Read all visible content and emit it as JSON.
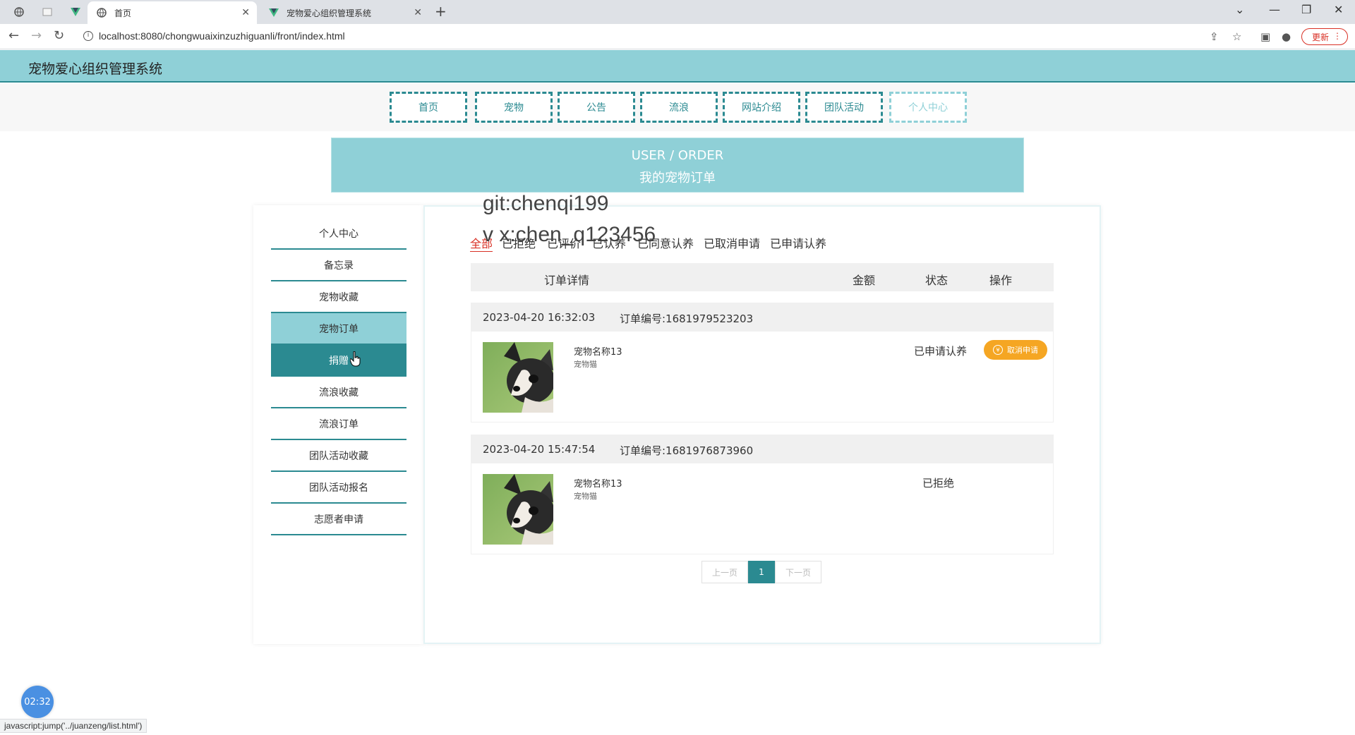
{
  "browser": {
    "tabs": [
      {
        "label": "首页",
        "icon": "globe-icon",
        "active": true
      },
      {
        "label": "宠物爱心组织管理系统",
        "icon": "vue-logo-icon",
        "active": false
      }
    ],
    "url": "localhost:8080/chongwuaixinzuzhiguanli/front/index.html",
    "update_label": "更新",
    "status_text": "javascript:jump('../juanzeng/list.html')"
  },
  "site": {
    "title": "宠物爱心组织管理系统",
    "menu": [
      "首页",
      "宠物",
      "公告",
      "流浪",
      "网站介绍",
      "团队活动",
      "个人中心"
    ],
    "banner_en": "USER / ORDER",
    "banner_zh": "我的宠物订单"
  },
  "sidebar": {
    "items": [
      "个人中心",
      "备忘录",
      "宠物收藏",
      "宠物订单",
      "捐赠",
      "流浪收藏",
      "流浪订单",
      "团队活动收藏",
      "团队活动报名",
      "志愿者申请"
    ]
  },
  "watermark": {
    "line1": "git:chenqi199",
    "line2": "v x:chen_q123456"
  },
  "filters": [
    "全部",
    "已拒绝",
    "已评价",
    "已认养",
    "已同意认养",
    "已取消申请",
    "已申请认养"
  ],
  "table": {
    "headers": [
      "订单详情",
      "金额",
      "状态",
      "操作"
    ]
  },
  "orders": [
    {
      "date": "2023-04-20 16:32:03",
      "order_no": "订单编号:1681979523203",
      "pet_name": "宠物名称13",
      "pet_category": "宠物猫",
      "status": "已申请认养",
      "action": "取消申请"
    },
    {
      "date": "2023-04-20 15:47:54",
      "order_no": "订单编号:1681976873960",
      "pet_name": "宠物名称13",
      "pet_category": "宠物猫",
      "status": "已拒绝",
      "action": ""
    }
  ],
  "pager": {
    "prev": "上一页",
    "current": "1",
    "next": "下一页"
  },
  "timer": "02:32",
  "colors": {
    "header_bg": "#8fd0d7",
    "accent": "#2b8a91",
    "button": "#f5a623",
    "active_filter": "#d93025"
  }
}
